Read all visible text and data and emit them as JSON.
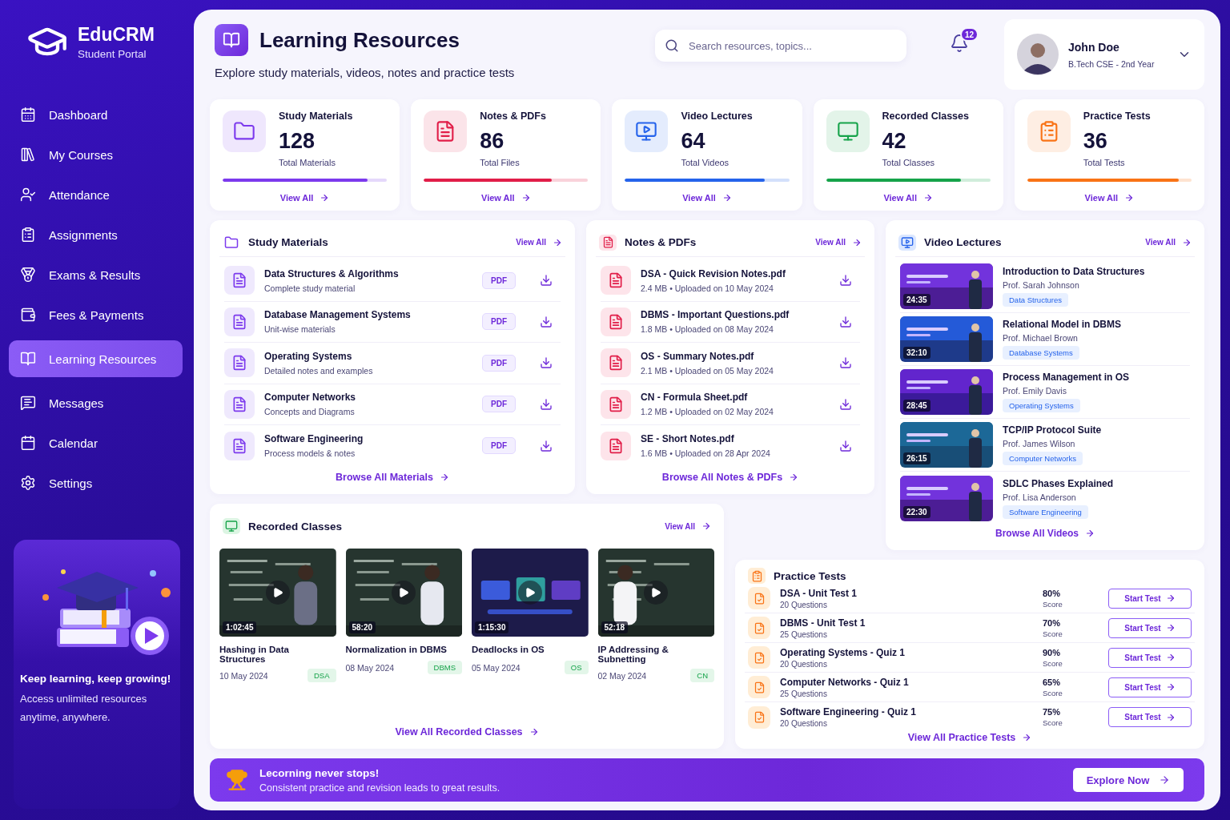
{
  "brand": {
    "name": "EduCRM",
    "subtitle": "Student Portal"
  },
  "nav": [
    {
      "label": "Dashboard",
      "selected": false
    },
    {
      "label": "My Courses",
      "selected": false
    },
    {
      "label": "Attendance",
      "selected": false
    },
    {
      "label": "Assignments",
      "selected": false
    },
    {
      "label": "Exams & Results",
      "selected": false
    },
    {
      "label": "Fees & Payments",
      "selected": false
    },
    {
      "label": "Learning Resources",
      "selected": true
    },
    {
      "label": "Messages",
      "selected": false
    },
    {
      "label": "Calendar",
      "selected": false
    },
    {
      "label": "Settings",
      "selected": false
    }
  ],
  "promo": {
    "title": "Keep learning, keep growing!",
    "text": "Access unlimited resources anytime, anywhere."
  },
  "header": {
    "title": "Learning Resources",
    "subtitle": "Explore study materials, videos, notes and practice tests",
    "search": {
      "placeholder": "Search resources, topics..."
    },
    "notifications": "12",
    "user": {
      "name": "John Doe",
      "detail": "B.Tech CSE - 2nd Year"
    }
  },
  "stats": [
    {
      "title": "Study Materials",
      "value": "128",
      "caption": "Total Materials",
      "level": 0.88,
      "color": "#7c3aed",
      "link": "View All"
    },
    {
      "title": "Notes & PDFs",
      "value": "86",
      "caption": "Total Files",
      "level": 0.78,
      "color": "#e11d48",
      "link": "View All"
    },
    {
      "title": "Video Lectures",
      "value": "64",
      "caption": "Total Videos",
      "level": 0.85,
      "color": "#2563eb",
      "link": "View All"
    },
    {
      "title": "Recorded Classes",
      "value": "42",
      "caption": "Total Classes",
      "level": 0.82,
      "color": "#16a34a",
      "link": "View All"
    },
    {
      "title": "Practice Tests",
      "value": "36",
      "caption": "Total Tests",
      "level": 0.92,
      "color": "#f97316",
      "link": "View All"
    }
  ],
  "study_materials": {
    "title": "Study Materials",
    "link": "View All",
    "footer": "Browse All Materials",
    "items": [
      {
        "name": "Data Structures & Algorithms",
        "description": "Complete study material",
        "format": "PDF"
      },
      {
        "name": "Database Management Systems",
        "description": "Unit-wise materials",
        "format": "PDF"
      },
      {
        "name": "Operating Systems",
        "description": "Detailed notes and examples",
        "format": "PDF"
      },
      {
        "name": "Computer Networks",
        "description": "Concepts and Diagrams",
        "format": "PDF"
      },
      {
        "name": "Software Engineering",
        "description": "Process models & notes",
        "format": "PDF"
      }
    ]
  },
  "notes": {
    "title": "Notes & PDFs",
    "link": "View All",
    "footer": "Browse All Notes & PDFs",
    "items": [
      {
        "name": "DSA - Quick Revision Notes.pdf",
        "meta": "2.4 MB • Uploaded on 10 May 2024"
      },
      {
        "name": "DBMS - Important Questions.pdf",
        "meta": "1.8 MB • Uploaded on 08 May 2024"
      },
      {
        "name": "OS - Summary Notes.pdf",
        "meta": "2.1 MB • Uploaded on 05 May 2024"
      },
      {
        "name": "CN - Formula Sheet.pdf",
        "meta": "1.2 MB • Uploaded on 02 May 2024"
      },
      {
        "name": "SE - Short Notes.pdf",
        "meta": "1.6 MB • Uploaded on 28 Apr 2024"
      }
    ]
  },
  "video_lectures": {
    "title": "Video Lectures",
    "link": "View All",
    "footer": "Browse All Videos",
    "items": [
      {
        "duration": "24:35",
        "title": "Introduction to Data Structures",
        "instructor": "Prof. Sarah Johnson",
        "tag": "Data Structures"
      },
      {
        "duration": "32:10",
        "title": "Relational Model in DBMS",
        "instructor": "Prof. Michael Brown",
        "tag": "Database Systems"
      },
      {
        "duration": "28:45",
        "title": "Process Management in OS",
        "instructor": "Prof. Emily Davis",
        "tag": "Operating Systems"
      },
      {
        "duration": "26:15",
        "title": "TCP/IP Protocol Suite",
        "instructor": "Prof. James Wilson",
        "tag": "Computer Networks"
      },
      {
        "duration": "22:30",
        "title": "SDLC Phases Explained",
        "instructor": "Prof. Lisa Anderson",
        "tag": "Software Engineering"
      }
    ]
  },
  "recorded_classes": {
    "title": "Recorded Classes",
    "link": "View All",
    "footer": "View All Recorded Classes",
    "items": [
      {
        "duration": "1:02:45",
        "title": "Hashing in Data Structures",
        "date": "10 May 2024",
        "tag": "DSA"
      },
      {
        "duration": "58:20",
        "title": "Normalization in DBMS",
        "date": "08 May 2024",
        "tag": "DBMS"
      },
      {
        "duration": "1:15:30",
        "title": "Deadlocks in OS",
        "date": "05 May 2024",
        "tag": "OS"
      },
      {
        "duration": "52:18",
        "title": "IP Addressing & Subnetting",
        "date": "02 May 2024",
        "tag": "CN"
      }
    ]
  },
  "practice_tests": {
    "title": "Practice Tests",
    "footer": "View All Practice Tests",
    "items": [
      {
        "title": "DSA - Unit Test 1",
        "questions": "20 Questions",
        "score": "80%",
        "score_label": "Score",
        "action": "Start Test"
      },
      {
        "title": "DBMS - Unit Test 1",
        "questions": "25 Questions",
        "score": "70%",
        "score_label": "Score",
        "action": "Start Test"
      },
      {
        "title": "Operating Systems - Quiz 1",
        "questions": "20 Questions",
        "score": "90%",
        "score_label": "Score",
        "action": "Start Test"
      },
      {
        "title": "Computer Networks - Quiz 1",
        "questions": "25 Questions",
        "score": "65%",
        "score_label": "Score",
        "action": "Start Test"
      },
      {
        "title": "Software Engineering - Quiz 1",
        "questions": "20 Questions",
        "score": "75%",
        "score_label": "Score",
        "action": "Start Test"
      }
    ]
  },
  "banner": {
    "title": "Lecorning never stops!",
    "text": "Consistent practice and revision leads to great results.",
    "action": "Explore Now"
  }
}
